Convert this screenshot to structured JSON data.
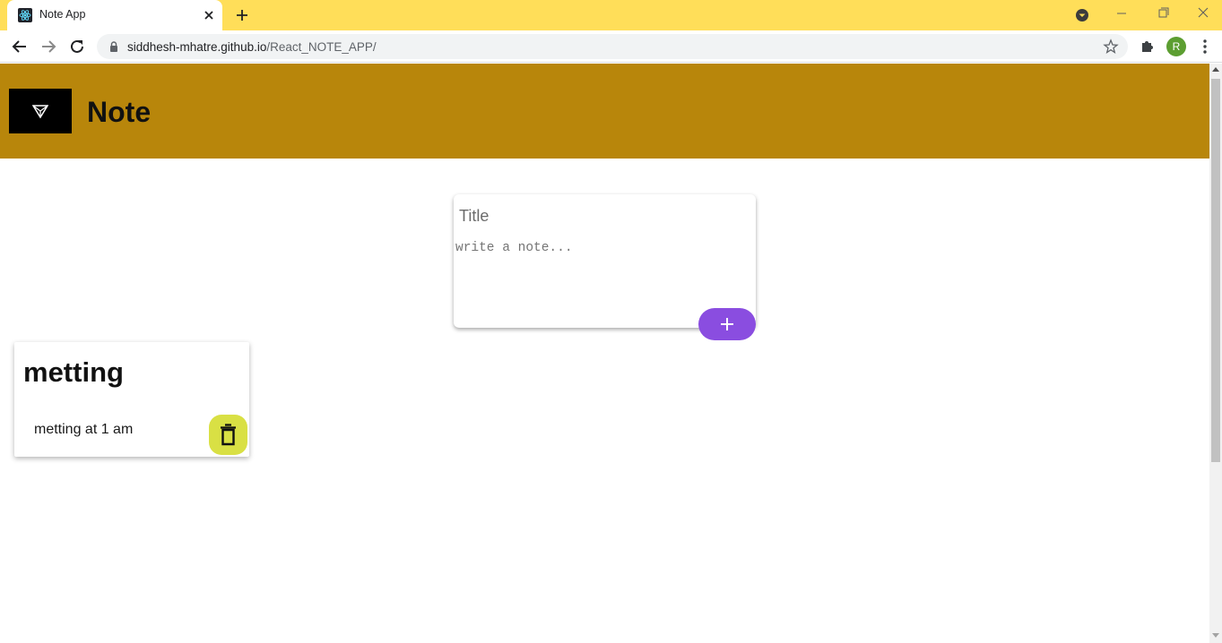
{
  "browser": {
    "tab_title": "Note App",
    "url_domain": "siddhesh-mhatre.github.io",
    "url_path": "/React_NOTE_APP/",
    "profile_initial": "R",
    "theme_color": "#ffde59"
  },
  "app": {
    "title": "Note",
    "header_color": "#b8860b",
    "form": {
      "title_placeholder": "Title",
      "content_placeholder": "write a note...",
      "add_button_icon": "plus-icon",
      "add_button_color": "#8a4de0"
    },
    "notes": [
      {
        "title": "metting",
        "content": "metting at 1 am",
        "delete_icon": "trash-icon",
        "delete_button_color": "#d9e044"
      }
    ]
  }
}
